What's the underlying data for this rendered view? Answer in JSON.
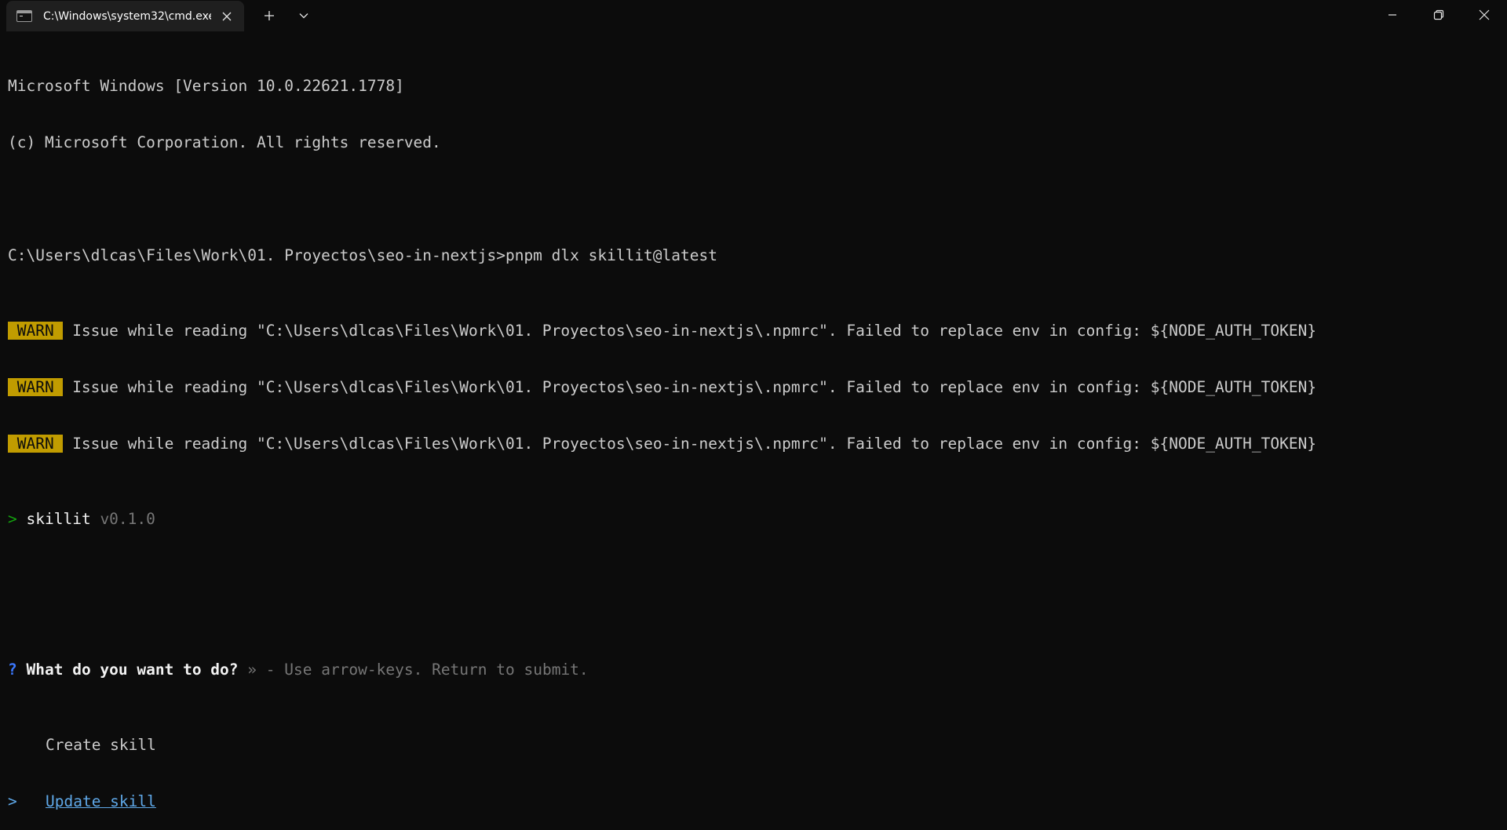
{
  "window": {
    "tab_title": "C:\\Windows\\system32\\cmd.exe",
    "icons": {
      "tab": "terminal-icon",
      "close_tab": "close-icon",
      "new_tab": "plus-icon",
      "dropdown": "chevron-down-icon",
      "minimize": "minimize-icon",
      "maximize": "restore-icon",
      "close": "close-icon"
    }
  },
  "colors": {
    "background": "#0c0c0c",
    "tab_background": "#1f1f1f",
    "text": "#cccccc",
    "warn_badge": "#c19c00",
    "prompt_green": "#13a10e",
    "question_blue": "#3b78ff",
    "selected": "#5fa8e8",
    "dim": "#767676"
  },
  "terminal": {
    "banner_version": "Microsoft Windows [Version 10.0.22621.1778]",
    "banner_copyright": "(c) Microsoft Corporation. All rights reserved.",
    "command": "C:\\Users\\dlcas\\Files\\Work\\01. Proyectos\\seo-in-nextjs>pnpm dlx skillit@latest",
    "warnings": [
      {
        "badge": " WARN ",
        "message": " Issue while reading \"C:\\Users\\dlcas\\Files\\Work\\01. Proyectos\\seo-in-nextjs\\.npmrc\". Failed to replace env in config: ${NODE_AUTH_TOKEN}"
      },
      {
        "badge": " WARN ",
        "message": " Issue while reading \"C:\\Users\\dlcas\\Files\\Work\\01. Proyectos\\seo-in-nextjs\\.npmrc\". Failed to replace env in config: ${NODE_AUTH_TOKEN}"
      },
      {
        "badge": " WARN ",
        "message": " Issue while reading \"C:\\Users\\dlcas\\Files\\Work\\01. Proyectos\\seo-in-nextjs\\.npmrc\". Failed to replace env in config: ${NODE_AUTH_TOKEN}"
      }
    ],
    "app": {
      "prompt_marker": ">",
      "name": "skillit",
      "version": "v0.1.0"
    },
    "question": {
      "marker": "?",
      "text": "What do you want to do?",
      "hint": "» - Use arrow-keys. Return to submit."
    },
    "options": [
      {
        "label": "Create skill",
        "selected": false,
        "pointer": ""
      },
      {
        "label": "Update skill",
        "selected": true,
        "pointer": ">"
      }
    ]
  }
}
